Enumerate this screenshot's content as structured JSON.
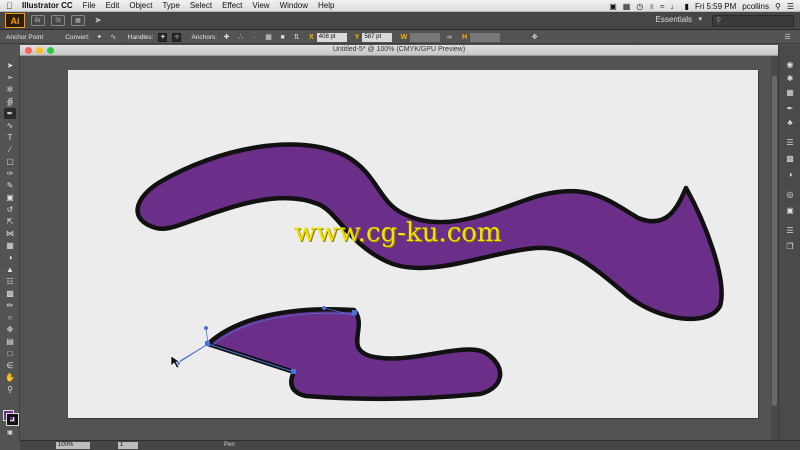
{
  "menubar": {
    "app_name": "Illustrator CC",
    "menus": [
      "File",
      "Edit",
      "Object",
      "Type",
      "Select",
      "Effect",
      "View",
      "Window",
      "Help"
    ],
    "clock": "Fri 5:59 PM",
    "user": "pcollins"
  },
  "appbar": {
    "logo": "Ai",
    "app_icons": [
      "Br",
      "St"
    ],
    "workspace": "Essentials"
  },
  "control_bar": {
    "selection_label": "Anchor Point",
    "convert_label": "Convert:",
    "handles_label": "Handles:",
    "anchors_label": "Anchors:",
    "x_label": "X",
    "x_value": "408 pt",
    "y_label": "Y",
    "y_value": "587 pt",
    "w_label": "W",
    "h_label": "H"
  },
  "document": {
    "title": "Untitled-5* @ 100% (CMYK/GPU Preview)",
    "watermark": "www.cg-ku.com"
  },
  "colors": {
    "fill": "#6b2f8a",
    "stroke": "#111111",
    "path_highlight": "#4a72d6",
    "accent": "#ff9a00"
  },
  "status_bar": {
    "zoom": "100%",
    "artboard_number": "1",
    "current_tool": "Pen"
  }
}
